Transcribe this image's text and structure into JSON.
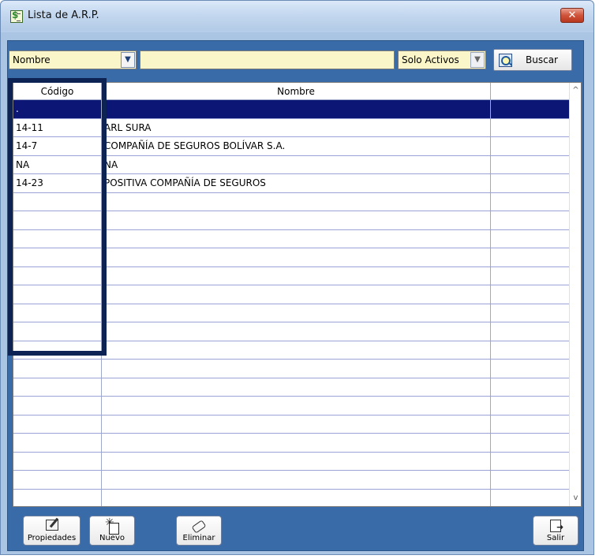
{
  "window": {
    "title": "Lista de A.R.P.",
    "close_label": "✕"
  },
  "searchbar": {
    "field_select": "Nombre",
    "search_value": "",
    "status_select": "Solo Activos",
    "buscar_label": "Buscar"
  },
  "grid": {
    "columns": [
      "Código",
      "Nombre",
      ""
    ],
    "rows": [
      {
        "code": ".",
        "name": "",
        "selected": true
      },
      {
        "code": "14-11",
        "name": "ARL SURA"
      },
      {
        "code": "14-7",
        "name": "COMPAÑÍA DE SEGUROS BOLÍVAR S.A."
      },
      {
        "code": "NA",
        "name": "NA"
      },
      {
        "code": "14-23",
        "name": "POSITIVA COMPAÑÍA DE SEGUROS"
      }
    ]
  },
  "toolbar": {
    "propiedades_label": "Propiedades",
    "nuevo_label": "Nuevo",
    "eliminar_label": "Eliminar",
    "salir_label": "Salir"
  },
  "colors": {
    "selection": "#0b1675",
    "highlight_box": "#0d2354",
    "panel": "#3a6ba9",
    "input_bg": "#fbf6c9"
  }
}
